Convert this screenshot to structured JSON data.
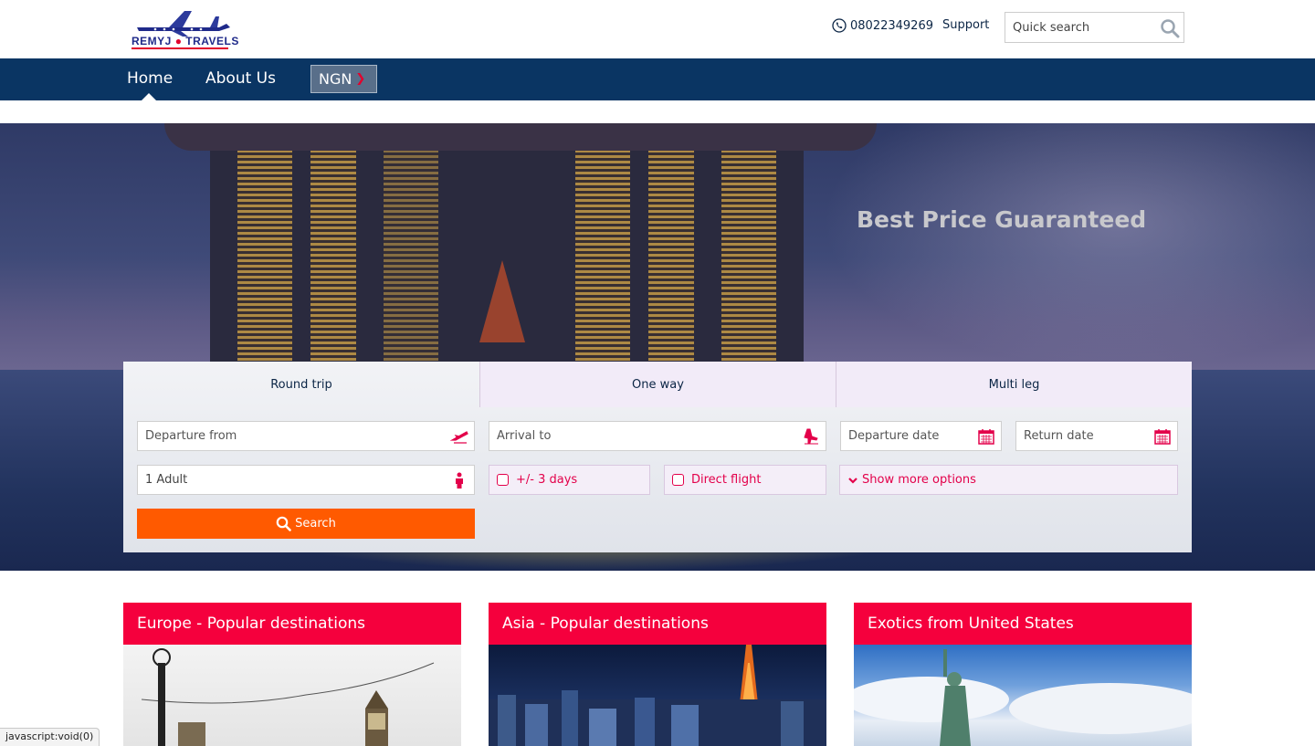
{
  "header": {
    "logo_text": "REMYJ TRAVELS",
    "logo_parts": [
      "REMYJ",
      "TRAVELS"
    ],
    "phone": "08022349269",
    "support_label": "Support",
    "search_placeholder": "Quick search"
  },
  "nav": {
    "items": [
      {
        "label": "Home",
        "active": true
      },
      {
        "label": "About Us",
        "active": false
      }
    ],
    "currency": "NGN"
  },
  "hero": {
    "tagline": "Best Price Guaranteed"
  },
  "search_form": {
    "tabs": [
      {
        "label": "Round trip",
        "active": true
      },
      {
        "label": "One way",
        "active": false
      },
      {
        "label": "Multi leg",
        "active": false
      }
    ],
    "departure_placeholder": "Departure from",
    "arrival_placeholder": "Arrival to",
    "departure_date_placeholder": "Departure date",
    "return_date_placeholder": "Return date",
    "passengers_value": "1 Adult",
    "flex_days_label": "+/- 3 days",
    "direct_flight_label": "Direct flight",
    "more_options_label": "Show more options",
    "search_label": "Search"
  },
  "destinations": [
    {
      "title": "Europe - Popular destinations"
    },
    {
      "title": "Asia - Popular destinations"
    },
    {
      "title": "Exotics from United States"
    }
  ],
  "status_bar": "javascript:void(0)",
  "colors": {
    "nav_bg": "#0a3563",
    "accent_pink": "#f5003d",
    "search_button": "#ff5a00",
    "text_dark": "#0b2545"
  },
  "icons": [
    "phone-icon",
    "search-icon",
    "chevron-down-icon",
    "plane-takeoff-icon",
    "plane-landing-icon",
    "calendar-icon",
    "person-icon"
  ]
}
